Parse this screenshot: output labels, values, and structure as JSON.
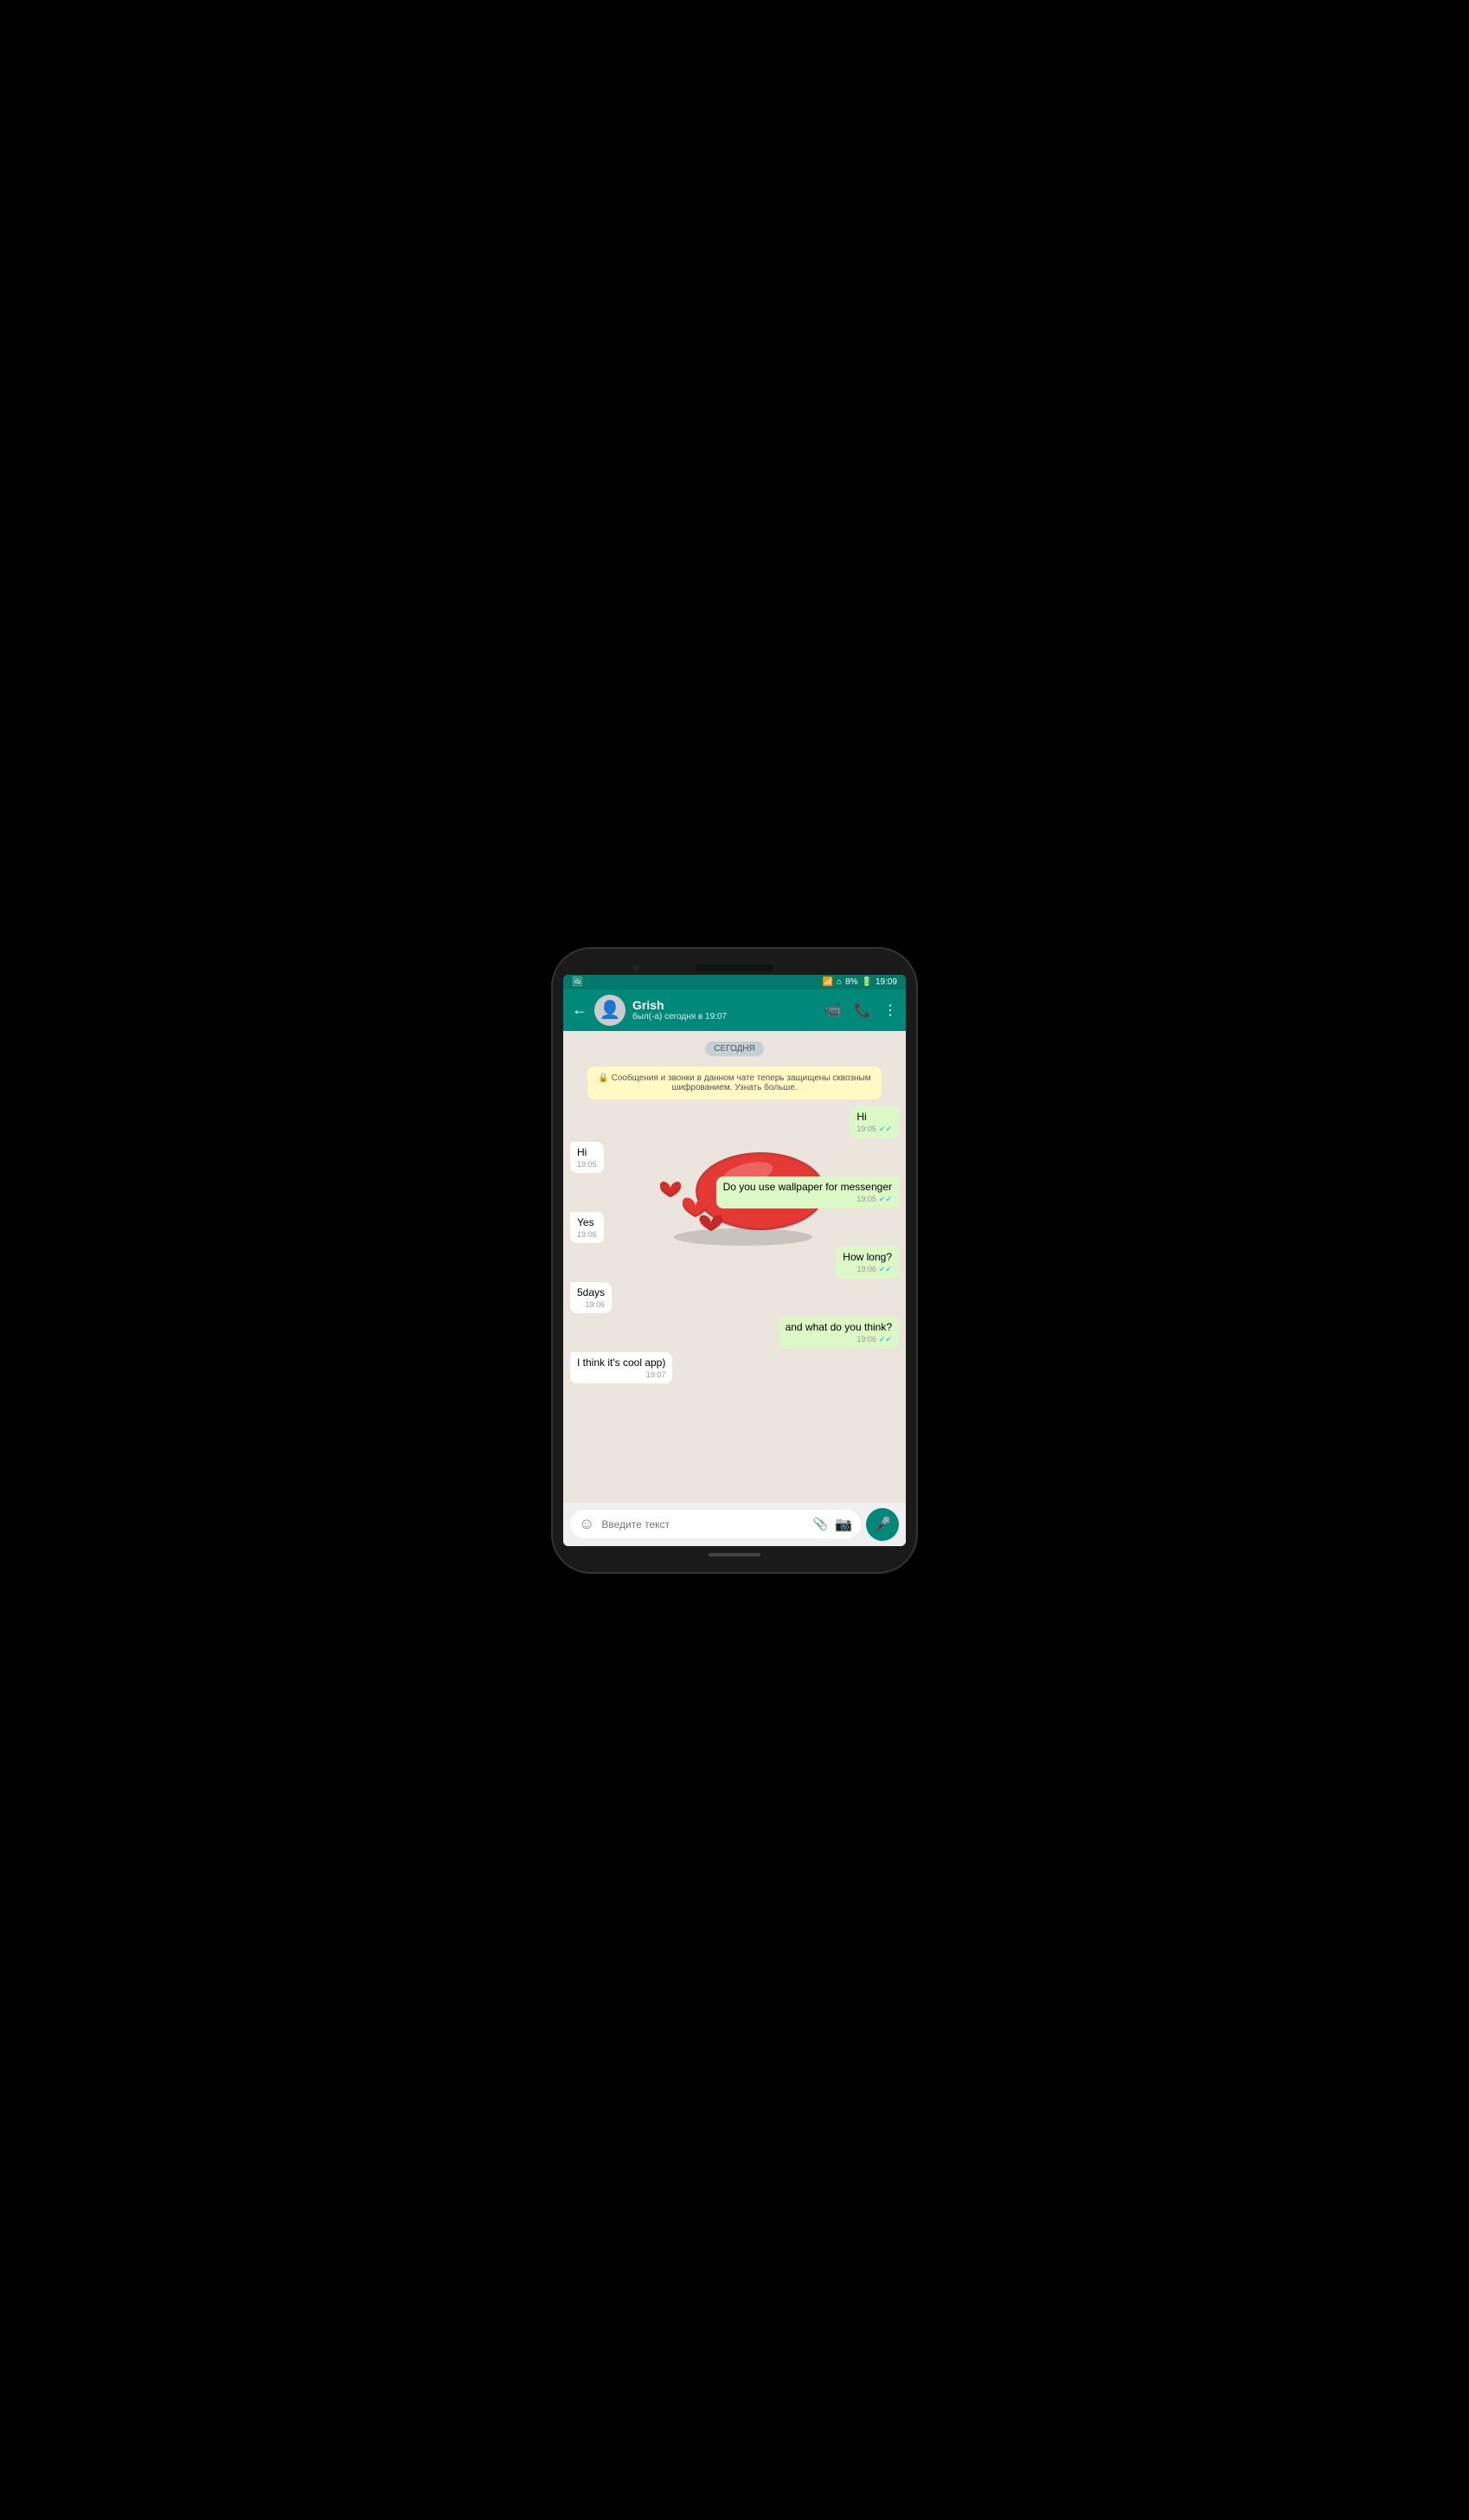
{
  "statusBar": {
    "wifi": "📶",
    "signal": "📶",
    "battery": "8%",
    "time": "19:09"
  },
  "header": {
    "backLabel": "←",
    "contactName": "Grish",
    "contactStatus": "был(-а) сегодня в 19:07",
    "videoCallIcon": "🎥",
    "callIcon": "📞",
    "menuIcon": "⋮"
  },
  "chat": {
    "dateBadge": "СЕГОДНЯ",
    "encryptionNotice": "🔒 Сообщения и звонки в данном чате теперь защищены сквозным шифрованием. Узнать больше.",
    "messages": [
      {
        "id": 1,
        "type": "sent",
        "text": "Hi",
        "time": "19:05",
        "status": "✔✔"
      },
      {
        "id": 2,
        "type": "received",
        "text": "Hi",
        "time": "19:05"
      },
      {
        "id": 3,
        "type": "sent",
        "text": "Do you use wallpaper for messenger",
        "time": "19:05",
        "status": "✔✔"
      },
      {
        "id": 4,
        "type": "received",
        "text": "Yes",
        "time": "19:06"
      },
      {
        "id": 5,
        "type": "sent",
        "text": "How long?",
        "time": "19:06",
        "status": "✔✔"
      },
      {
        "id": 6,
        "type": "received",
        "text": "5days",
        "time": "19:06"
      },
      {
        "id": 7,
        "type": "sent",
        "text": "and what do you think?",
        "time": "19:06",
        "status": "✔✔"
      },
      {
        "id": 8,
        "type": "received",
        "text": "I think it's cool app)",
        "time": "19:07"
      }
    ]
  },
  "inputArea": {
    "placeholder": "Введите текст"
  }
}
